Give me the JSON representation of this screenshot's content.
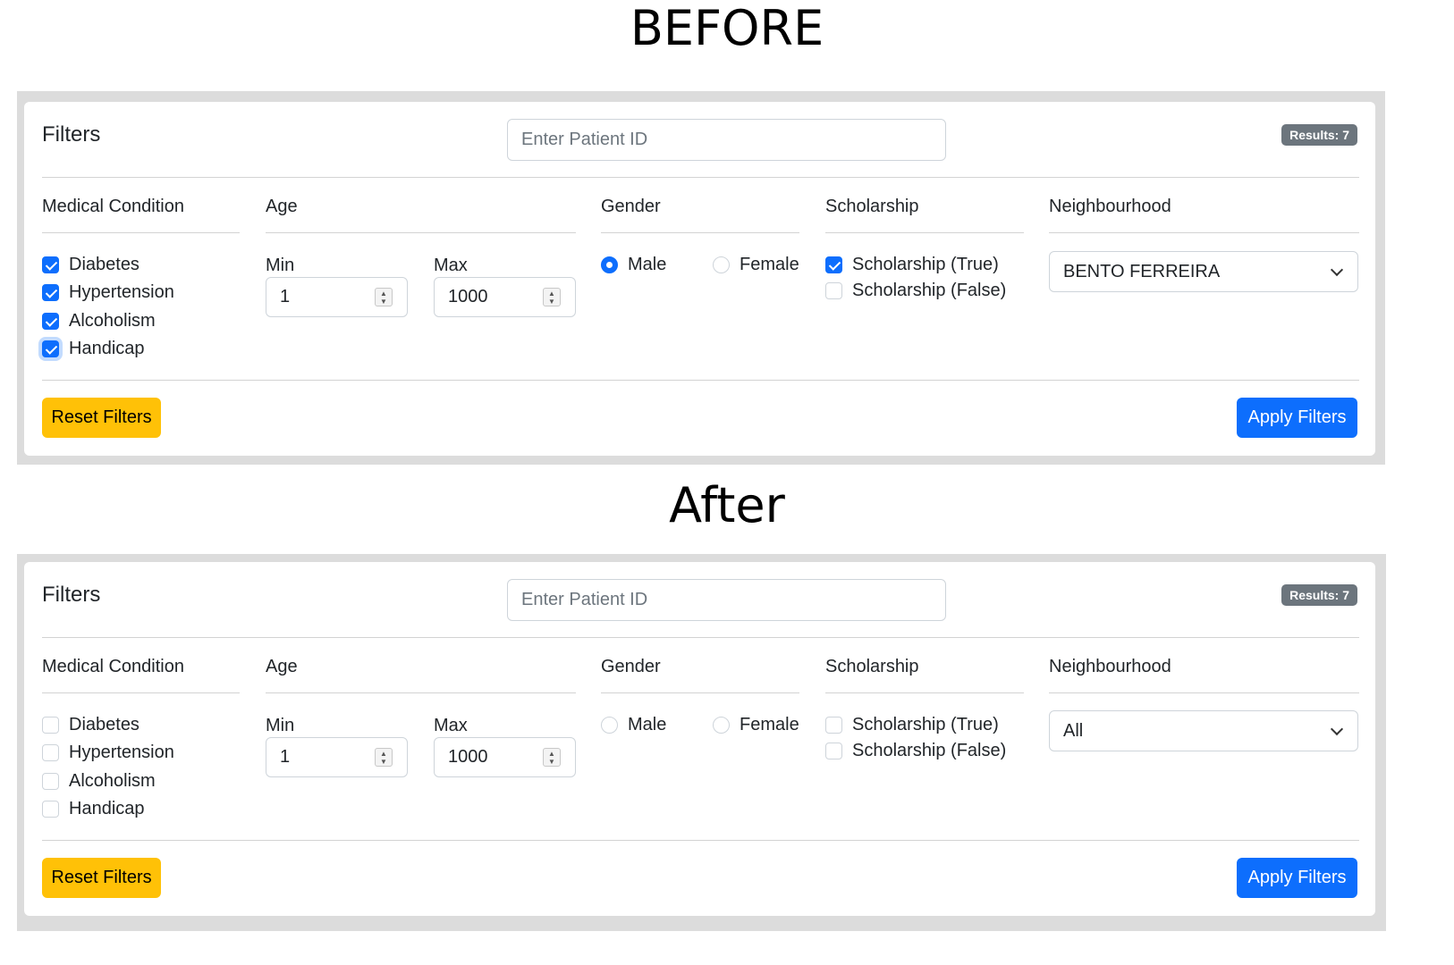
{
  "headings": {
    "before": "BEFORE",
    "after": "After"
  },
  "panels": {
    "before": {
      "title": "Filters",
      "patient_id_placeholder": "Enter Patient ID",
      "results_badge": "Results: 7",
      "medical_condition": {
        "heading": "Medical Condition",
        "items": [
          {
            "label": "Diabetes",
            "checked": true
          },
          {
            "label": "Hypertension",
            "checked": true
          },
          {
            "label": "Alcoholism",
            "checked": true
          },
          {
            "label": "Handicap",
            "checked": true
          }
        ]
      },
      "age": {
        "heading": "Age",
        "min_label": "Min",
        "min_value": "1",
        "max_label": "Max",
        "max_value": "1000"
      },
      "gender": {
        "heading": "Gender",
        "options": [
          {
            "label": "Male",
            "checked": true
          },
          {
            "label": "Female",
            "checked": false
          }
        ]
      },
      "scholarship": {
        "heading": "Scholarship",
        "options": [
          {
            "label": "Scholarship (True)",
            "checked": true
          },
          {
            "label": "Scholarship (False)",
            "checked": false
          }
        ]
      },
      "neighbourhood": {
        "heading": "Neighbourhood",
        "selected": "BENTO FERREIRA"
      },
      "reset_label": "Reset Filters",
      "apply_label": "Apply Filters"
    },
    "after": {
      "title": "Filters",
      "patient_id_placeholder": "Enter Patient ID",
      "results_badge": "Results: 7",
      "medical_condition": {
        "heading": "Medical Condition",
        "items": [
          {
            "label": "Diabetes",
            "checked": false
          },
          {
            "label": "Hypertension",
            "checked": false
          },
          {
            "label": "Alcoholism",
            "checked": false
          },
          {
            "label": "Handicap",
            "checked": false
          }
        ]
      },
      "age": {
        "heading": "Age",
        "min_label": "Min",
        "min_value": "1",
        "max_label": "Max",
        "max_value": "1000"
      },
      "gender": {
        "heading": "Gender",
        "options": [
          {
            "label": "Male",
            "checked": false
          },
          {
            "label": "Female",
            "checked": false
          }
        ]
      },
      "scholarship": {
        "heading": "Scholarship",
        "options": [
          {
            "label": "Scholarship (True)",
            "checked": false
          },
          {
            "label": "Scholarship (False)",
            "checked": false
          }
        ]
      },
      "neighbourhood": {
        "heading": "Neighbourhood",
        "selected": "All"
      },
      "reset_label": "Reset Filters",
      "apply_label": "Apply Filters"
    }
  },
  "colors": {
    "primary": "#0d6efd",
    "warning": "#ffc107",
    "badge": "#6c757d",
    "frame": "#dcdcdc"
  }
}
